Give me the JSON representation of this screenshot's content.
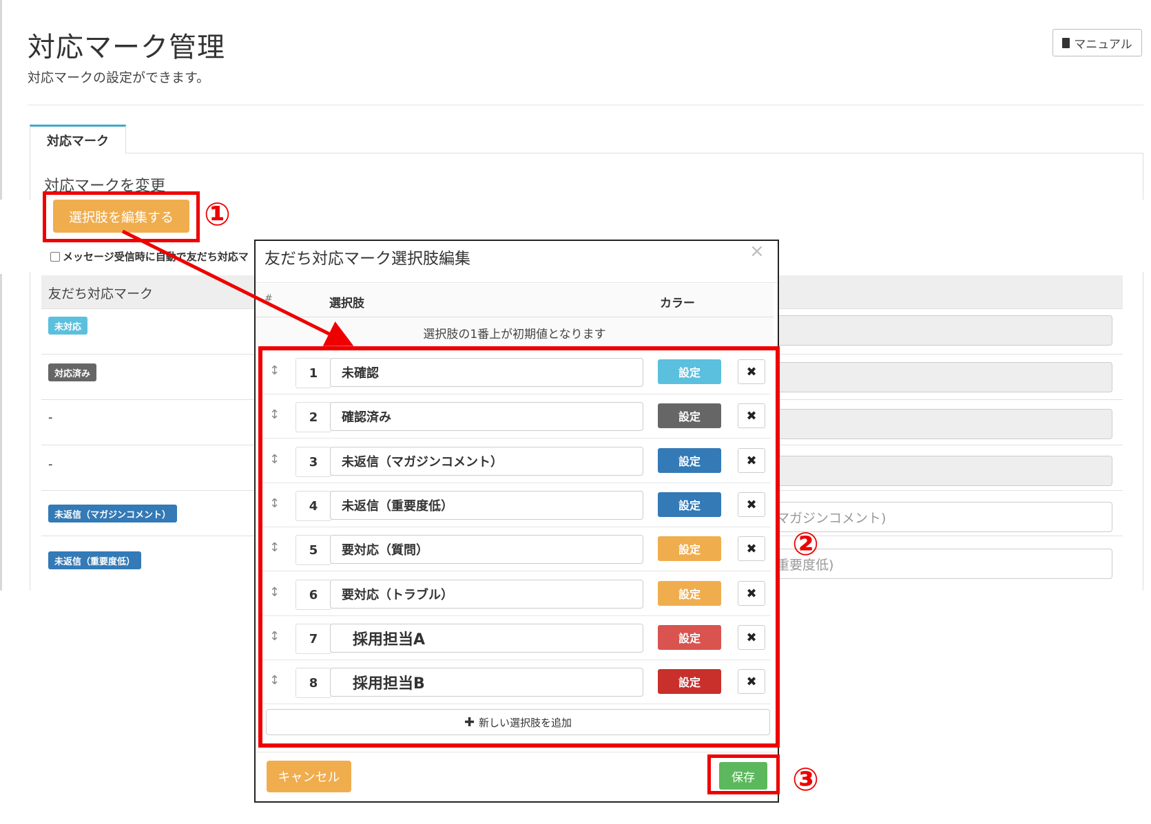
{
  "page": {
    "title": "対応マーク管理",
    "subtitle": "対応マークの設定ができます。",
    "manual_label": "マニュアル"
  },
  "tab": {
    "label": "対応マーク"
  },
  "section": {
    "title": "対応マークを変更",
    "edit_button": "選択肢を編集する",
    "auto_checkbox": "メッセージ受信時に自動で友だち対応マ"
  },
  "background_table": {
    "header": "友だち対応マーク",
    "rows": [
      {
        "badge": "未対応",
        "color": "#5bc0de",
        "input": ""
      },
      {
        "badge": "対応済み",
        "color": "#666666",
        "input": ""
      },
      {
        "badge": "-",
        "input": ""
      },
      {
        "badge": "-",
        "input": ""
      },
      {
        "badge": "未返信（マガジンコメント）",
        "color": "#337ab7",
        "input": "マガジンコメント)"
      },
      {
        "badge": "未返信（重要度低）",
        "color": "#337ab7",
        "input": "重要度低)"
      }
    ]
  },
  "modal": {
    "title": "友だち対応マーク選択肢編集",
    "close": "×",
    "header": {
      "hash": "#",
      "choice": "選択肢",
      "color": "カラー"
    },
    "note": "選択肢の1番上が初期値となります",
    "set_label": "設定",
    "options": [
      {
        "num": "1",
        "label": "未確認",
        "color": "#5bc0de"
      },
      {
        "num": "2",
        "label": "確認済み",
        "color": "#666666"
      },
      {
        "num": "3",
        "label": "未返信（マガジンコメント）",
        "color": "#337ab7"
      },
      {
        "num": "4",
        "label": "未返信（重要度低）",
        "color": "#337ab7"
      },
      {
        "num": "5",
        "label": "要対応（質問）",
        "color": "#f0ad4e"
      },
      {
        "num": "6",
        "label": "要対応（トラブル）",
        "color": "#f0ad4e"
      },
      {
        "num": "7",
        "label": "採用担当A",
        "color": "#d9534f"
      },
      {
        "num": "8",
        "label": "採用担当B",
        "color": "#c9302c"
      }
    ],
    "add_label": "新しい選択肢を追加",
    "cancel_label": "キャンセル",
    "save_label": "保存"
  },
  "annotations": {
    "one": "①",
    "two": "②",
    "three": "③",
    "highlight_color": "#ee0000"
  }
}
